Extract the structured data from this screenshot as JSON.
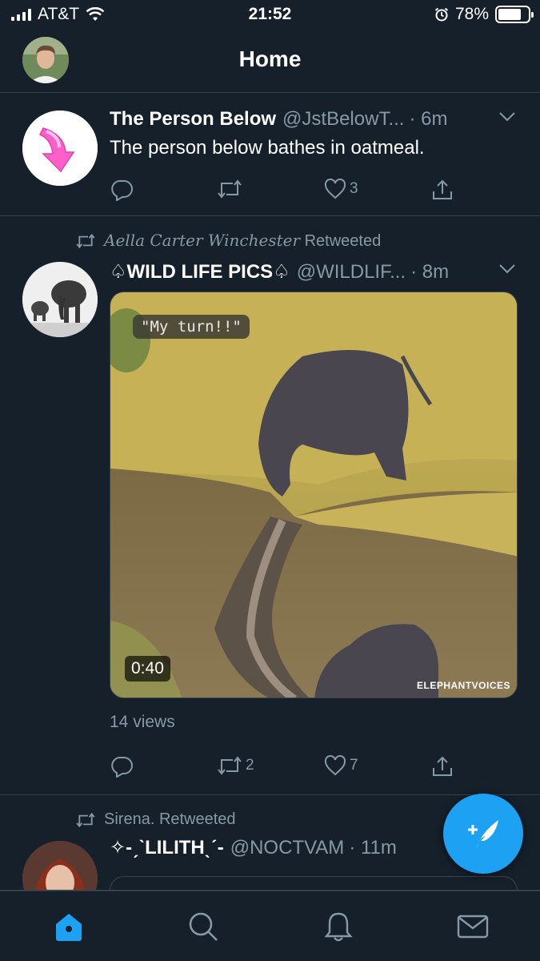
{
  "status_bar": {
    "carrier": "AT&T",
    "time": "21:52",
    "battery": "78%",
    "battery_level": 0.78
  },
  "header": {
    "title": "Home"
  },
  "tweets": [
    {
      "name": "The Person Below",
      "handle": "@JstBelowT...",
      "time": "· 6m",
      "text": "The person below bathes in oatmeal.",
      "reply_count": "",
      "retweet_count": "",
      "like_count": "3"
    },
    {
      "retweeted_by": "Aella Carter Winchester",
      "retweeted_label": "Retweeted",
      "name": "♤WILD LIFE PICS♤",
      "handle": "@WILDLIF...",
      "time": "· 8m",
      "media_caption": "\"My turn!!\"",
      "media_duration": "0:40",
      "media_watermark": "ELEPHANTVOICES",
      "views": "14 views",
      "reply_count": "",
      "retweet_count": "2",
      "like_count": "7"
    },
    {
      "retweeted_by": "Sirena.",
      "retweeted_label": "Retweeted",
      "name": "✧-ˏˋLILITHˎˊ-",
      "handle": "@NOCTVAM",
      "time": "· 11m"
    }
  ],
  "colors": {
    "background": "#15202b",
    "accent": "#1da1f2",
    "secondary_text": "#8899a6",
    "divider": "#38444d"
  },
  "icons": {
    "reply": "reply-icon",
    "retweet": "retweet-icon",
    "like": "heart-icon",
    "share": "share-icon",
    "compose": "compose-tweet-icon",
    "home": "home-icon",
    "search": "search-icon",
    "notifications": "bell-icon",
    "messages": "mail-icon"
  }
}
